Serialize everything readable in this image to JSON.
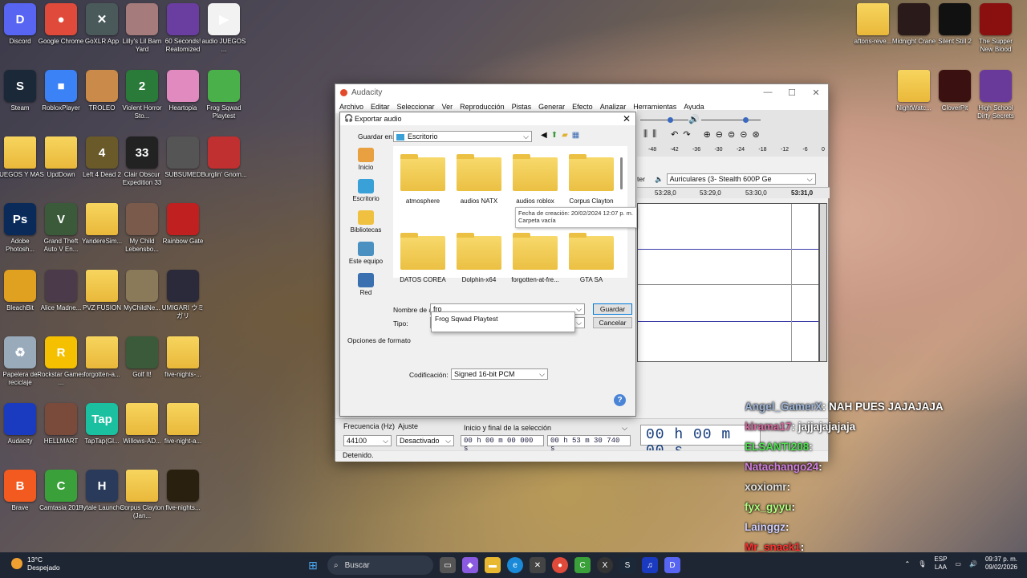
{
  "desktop": {
    "left_icons": [
      {
        "label": "Discord",
        "color": "#5865f2",
        "glyph": "D"
      },
      {
        "label": "Google Chrome",
        "color": "#e04a3a",
        "glyph": "●"
      },
      {
        "label": "GoXLR App",
        "color": "#4a5a5a",
        "glyph": "✕"
      },
      {
        "label": "Lilly's Lil Barn Yard",
        "color": "#a57b7b",
        "glyph": ""
      },
      {
        "label": "60 Seconds! Reatomized",
        "color": "#6a3ea0",
        "glyph": ""
      },
      {
        "label": "audio JUEGOS ...",
        "color": "#f2f2f2",
        "glyph": "▶"
      },
      {
        "label": "Steam",
        "color": "#1b2838",
        "glyph": "S"
      },
      {
        "label": "RobloxPlayer",
        "color": "#3b82f6",
        "glyph": "■"
      },
      {
        "label": "TROLEO",
        "color": "#c98a4a",
        "glyph": ""
      },
      {
        "label": "Violent Horror Sto...",
        "color": "#2a7a3a",
        "glyph": "2"
      },
      {
        "label": "Heartopia",
        "color": "#e08ac0",
        "glyph": ""
      },
      {
        "label": "Frog Sqwad Playtest",
        "color": "#4ab04a",
        "glyph": ""
      },
      {
        "label": "JUEGOS Y MAS",
        "color": "folder",
        "glyph": ""
      },
      {
        "label": "UpdDown",
        "color": "folder",
        "glyph": ""
      },
      {
        "label": "Left 4 Dead 2",
        "color": "#6a5a2a",
        "glyph": "4"
      },
      {
        "label": "Clair Obscur Expedition 33",
        "color": "#222",
        "glyph": "33"
      },
      {
        "label": "SUBSUMED",
        "color": "#555",
        "glyph": ""
      },
      {
        "label": "Burglin' Gnom...",
        "color": "#c03030",
        "glyph": ""
      },
      {
        "label": "Adobe Photosh...",
        "color": "#0a2a5a",
        "glyph": "Ps"
      },
      {
        "label": "Grand Theft Auto V En...",
        "color": "#3a5a3a",
        "glyph": "V"
      },
      {
        "label": "YandereSim...",
        "color": "folder",
        "glyph": ""
      },
      {
        "label": "My Child Lebensbo...",
        "color": "#7a5a4a",
        "glyph": ""
      },
      {
        "label": "Rainbow Gate",
        "color": "#c02020",
        "glyph": ""
      },
      {
        "label": "BleachBit",
        "color": "#e0a020",
        "glyph": ""
      },
      {
        "label": "Alice Madne...",
        "color": "#4a3a4a",
        "glyph": ""
      },
      {
        "label": "PVZ FUSION",
        "color": "folder",
        "glyph": ""
      },
      {
        "label": "MyChildNe...",
        "color": "#8a7a5a",
        "glyph": ""
      },
      {
        "label": "UMIGARI ウミガリ",
        "color": "#2a2a3a",
        "glyph": ""
      },
      {
        "label": "Papelera de reciclaje",
        "color": "#9ab",
        "glyph": "♻"
      },
      {
        "label": "Rockstar Games ...",
        "color": "#f5c000",
        "glyph": "R"
      },
      {
        "label": "forgotten-a...",
        "color": "folder",
        "glyph": ""
      },
      {
        "label": "Golf It!",
        "color": "#3a5a3a",
        "glyph": ""
      },
      {
        "label": "five-nights-...",
        "color": "folder",
        "glyph": ""
      },
      {
        "label": "Audacity",
        "color": "#1a3ac0",
        "glyph": ""
      },
      {
        "label": "HELLMART",
        "color": "#7a4a3a",
        "glyph": ""
      },
      {
        "label": "TapTap(Gl...",
        "color": "#1ac0a0",
        "glyph": "Tap"
      },
      {
        "label": "Willows-AD...",
        "color": "folder",
        "glyph": ""
      },
      {
        "label": "five-night-a...",
        "color": "folder",
        "glyph": ""
      },
      {
        "label": "Brave",
        "color": "#f25a20",
        "glyph": "B"
      },
      {
        "label": "Camtasia 2019",
        "color": "#3aa03a",
        "glyph": "C"
      },
      {
        "label": "Hytale Launcher",
        "color": "#2a3a5a",
        "glyph": "H"
      },
      {
        "label": "Corpus Clayton (Jan...",
        "color": "folder",
        "glyph": ""
      },
      {
        "label": "five-nights...",
        "color": "#2a2010",
        "glyph": ""
      }
    ],
    "right_icons": [
      {
        "label": "aftons-reve...",
        "color": "folder",
        "glyph": ""
      },
      {
        "label": "Midnight Crane",
        "color": "#2a1a1a",
        "glyph": ""
      },
      {
        "label": "Silent Still 2",
        "color": "#111",
        "glyph": ""
      },
      {
        "label": "The Supper New Blood",
        "color": "#8a1010",
        "glyph": ""
      },
      {
        "label": "NightWatc...",
        "color": "folder",
        "glyph": ""
      },
      {
        "label": "CloverPit",
        "color": "#3a1010",
        "glyph": ""
      },
      {
        "label": "High School Dirty Secrets",
        "color": "#6a3a9a",
        "glyph": ""
      }
    ]
  },
  "audacity": {
    "title": "Audacity",
    "menu": [
      "Archivo",
      "Editar",
      "Seleccionar",
      "Ver",
      "Reproducción",
      "Pistas",
      "Generar",
      "Efecto",
      "Analizar",
      "Herramientas",
      "Ayuda"
    ],
    "meter_ticks": [
      "-48",
      "-42",
      "-36",
      "-30",
      "-24",
      "-18",
      "-12",
      "-6",
      "0"
    ],
    "output_device": "Auriculares (3- Stealth 600P Ge",
    "ruler_times": [
      "53:28,0",
      "53:29,0",
      "53:30,0",
      "53:31,0"
    ],
    "ruler_prefix": "ter",
    "frecuencia_label": "Frecuencia (Hz)",
    "frecuencia_value": "44100",
    "ajuste_label": "Ajuste",
    "ajuste_value": "Desactivado",
    "seleccion_label": "Inicio y final de la selección",
    "sel_start": "00 h 00 m 00 000 s",
    "sel_end": "00 h 53 m 30 740 s",
    "big_time": "00 h 00 m 00 s",
    "status": "Detenido."
  },
  "export": {
    "title": "Exportar audio",
    "guardar_en_label": "Guardar en:",
    "guardar_en_value": "Escritorio",
    "places": [
      {
        "label": "Inicio",
        "color": "#e8a040"
      },
      {
        "label": "Escritorio",
        "color": "#3aa0d8"
      },
      {
        "label": "Bibliotecas",
        "color": "#f0c040"
      },
      {
        "label": "Este equipo",
        "color": "#4a90c0"
      },
      {
        "label": "Red",
        "color": "#3a70b0"
      }
    ],
    "files": [
      "atmosphere",
      "audios NATX",
      "audios roblox",
      "Corpus Clayton",
      "DATOS COREA",
      "Dolphin-x64",
      "forgotten-at-fre...",
      "GTA SA"
    ],
    "tooltip_line1": "Fecha de creación: 20/02/2024 12:07 p. m.",
    "tooltip_line2": "Carpeta vacía",
    "nombre_label": "Nombre de archivo:",
    "nombre_value": "fro",
    "tipo_label": "Tipo:",
    "autocomplete": "Frog Sqwad Playtest",
    "guardar_btn": "Guardar",
    "cancelar_btn": "Cancelar",
    "opciones_label": "Opciones de formato",
    "codificacion_label": "Codificación:",
    "codificacion_value": "Signed 16-bit PCM"
  },
  "chat": [
    {
      "user": "Angel_GamerX",
      "text": ": NAH PUES JAJAJAJA",
      "color": "#9fb6d8"
    },
    {
      "user": "kirama17",
      "text": ": jajjajajajaja",
      "color": "#d86aa0"
    },
    {
      "user": "ELSANTI208",
      "text": ":",
      "color": "#50e050"
    },
    {
      "user": "Natachango24",
      "text": ":",
      "color": "#d080e0"
    },
    {
      "user": "xoxiomr",
      "text": ":",
      "color": "#e0e0e0"
    },
    {
      "user": "fyx_gyyu",
      "text": ":",
      "color": "#b0ff80"
    },
    {
      "user": "Lainggz",
      "text": ":",
      "color": "#d0d0ff"
    },
    {
      "user": "Mr_snack1",
      "text": ":",
      "color": "#ff3030"
    }
  ],
  "taskbar": {
    "temp": "13°C",
    "weather": "Despejado",
    "search": "Buscar",
    "lang1": "ESP",
    "lang2": "LAA",
    "time": "09:37 p. m.",
    "date": "09/02/2026"
  }
}
